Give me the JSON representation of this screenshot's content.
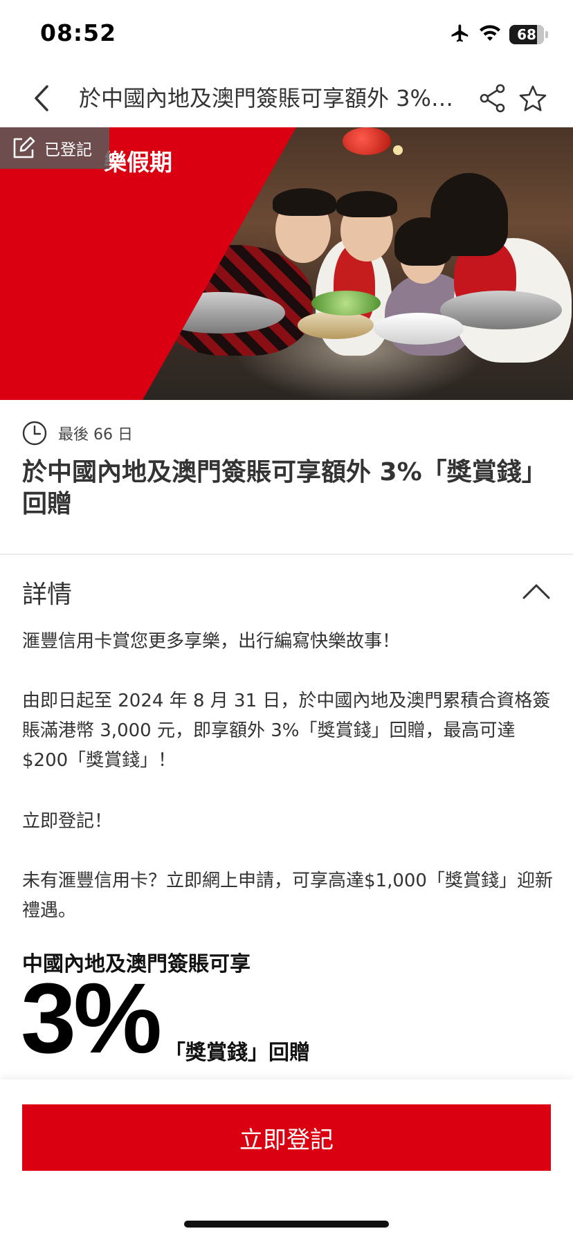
{
  "status_bar": {
    "time": "08:52",
    "battery": "68",
    "icons": [
      "airplane-icon",
      "wifi-icon",
      "battery-icon"
    ]
  },
  "nav": {
    "title": "於中國內地及澳門簽賬可享額外 3%「獎賞錢」回贈",
    "icons": [
      "back-icon",
      "share-icon",
      "star-icon"
    ]
  },
  "hero": {
    "banner_text": "樂假期",
    "registered_label": "已登記"
  },
  "countdown": {
    "text": "最後 66 日"
  },
  "offer_title": "於中國內地及澳門簽賬可享額外 3%「獎賞錢」回贈",
  "details": {
    "heading": "詳情",
    "paragraphs": [
      "滙豐信用卡賞您更多享樂，出行編寫快樂故事！",
      "由即日起至 2024 年 8 月 31 日，於中國內地及澳門累積合資格簽賬滿港幣 3,000 元，即享額外 3%「獎賞錢」回贈，最高可達$200「獎賞錢」！",
      "立即登記！",
      "未有滙豐信用卡？立即網上申請，可享高達$1,000「獎賞錢」迎新禮遇。"
    ]
  },
  "promo": {
    "subtitle": "中國內地及澳門簽賬可享",
    "big_value": "3%",
    "tail": "「獎賞錢」回贈"
  },
  "cta": {
    "label": "立即登記"
  },
  "colors": {
    "brand_red": "#db0011"
  }
}
